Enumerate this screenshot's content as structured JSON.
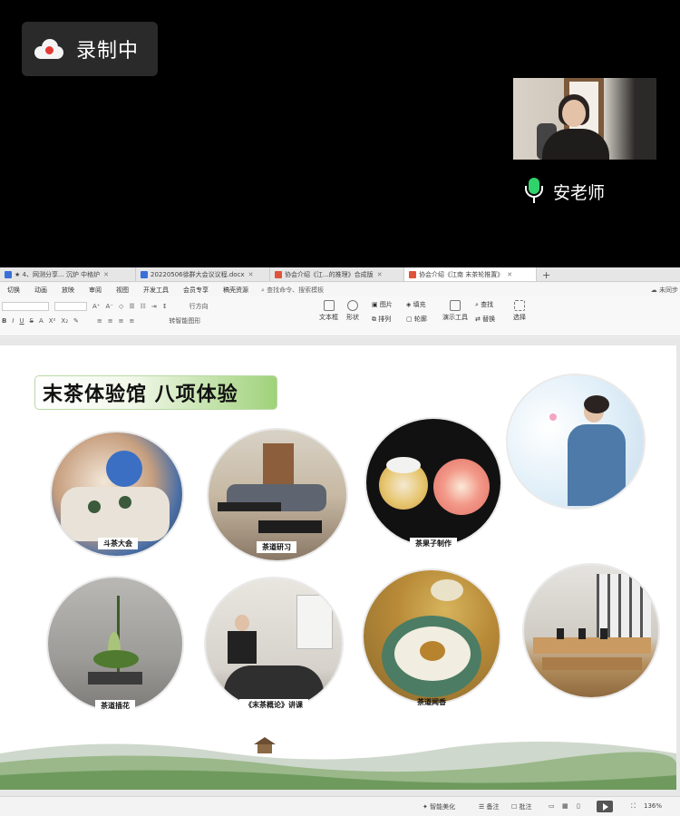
{
  "recording": {
    "label": "录制中"
  },
  "participant": {
    "name": "安老师"
  },
  "tabs": [
    {
      "label": "★ 4、网测分享... 沉炉 中格炉",
      "color": "#3b6fd8"
    },
    {
      "label": "20220506徐群大会议议程.docx",
      "color": "#3b6fd8"
    },
    {
      "label": "协会介绍《江...的推理》合成版",
      "color": "#e0533a"
    },
    {
      "label": "协会介绍《江南 末茶轮推置》",
      "color": "#e0533a",
      "active": true
    }
  ],
  "menu": {
    "items": [
      "切换",
      "动画",
      "放映",
      "审阅",
      "视图",
      "开发工具",
      "会员专享",
      "稿壳资源"
    ],
    "search": "查找命令、搜索模板",
    "unsynced": "未同步"
  },
  "ribbon": {
    "groups": [
      "文本框",
      "形状",
      "图片",
      "填充",
      "排列",
      "轮廓",
      "演示工具",
      "查找",
      "替换",
      "选择"
    ],
    "extra": [
      "行方向",
      "转智能图形"
    ]
  },
  "slide": {
    "title": "末茶体验馆 八项体验",
    "items": [
      {
        "caption": "斗茶大会"
      },
      {
        "caption": "茶道研习"
      },
      {
        "caption": "茶果子制作"
      },
      {
        "caption": ""
      },
      {
        "caption": "茶道插花"
      },
      {
        "caption": "《末茶概论》讲课"
      },
      {
        "caption": "茶道闻香"
      },
      {
        "caption": ""
      }
    ]
  },
  "status": {
    "smart": "智能美化",
    "notes": "备注",
    "comments": "批注",
    "zoom": "136%"
  }
}
